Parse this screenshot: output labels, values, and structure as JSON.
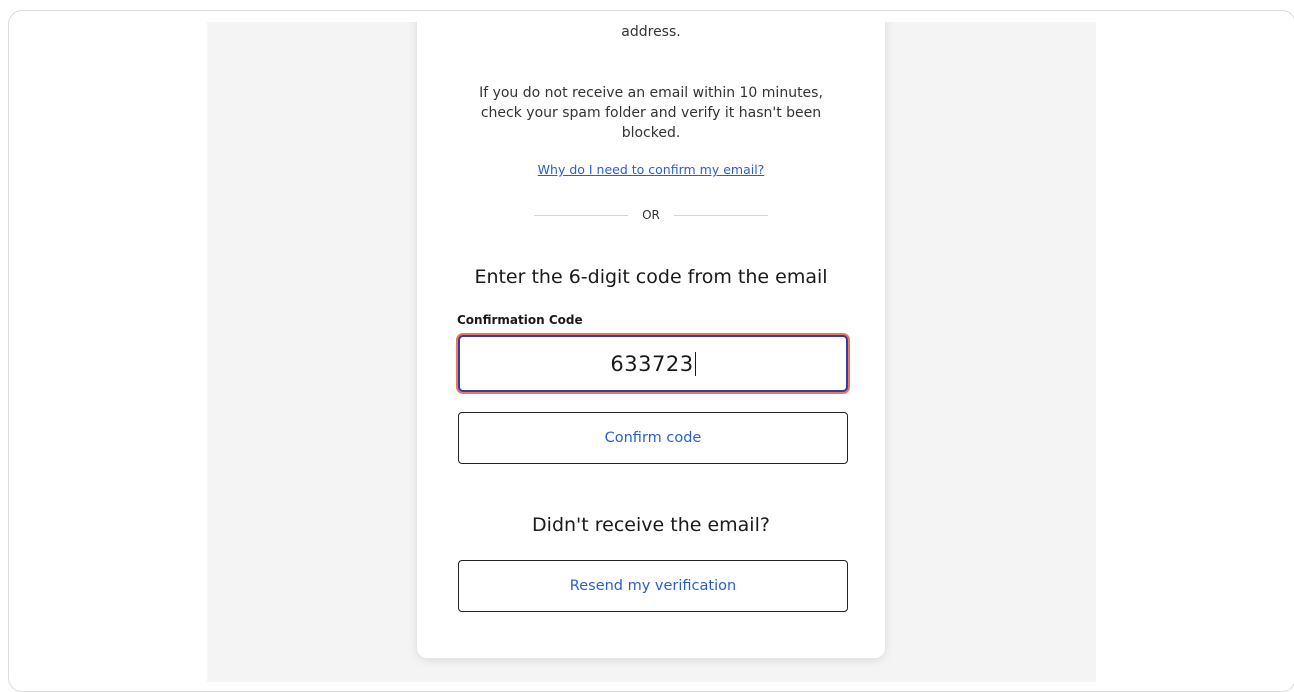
{
  "verify": {
    "intro_tail": "and click the link inside to confirm your email address.",
    "spam_note": "If you do not receive an email within 10 minutes, check your spam folder and verify it hasn't been blocked.",
    "why_link": "Why do I need to confirm my email?",
    "or_label": "OR",
    "code_heading": "Enter the 6-digit code from the email",
    "code_field_label": "Confirmation Code",
    "code_value": "633723",
    "confirm_button": "Confirm code",
    "resend_heading": "Didn't receive the email?",
    "resend_button": "Resend my verification"
  },
  "colors": {
    "link": "#2a5ecc",
    "input_border": "#2a3fa8",
    "focus_ring": "#f0735a",
    "page_bg": "#f4f4f4"
  }
}
